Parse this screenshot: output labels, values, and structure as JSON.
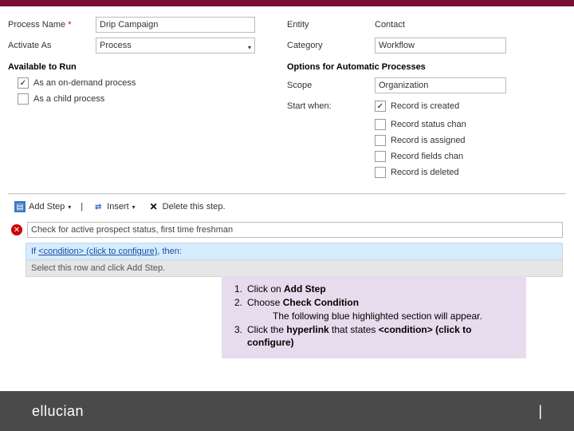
{
  "form": {
    "left": {
      "processNameLabel": "Process Name",
      "processNameValue": "Drip Campaign",
      "activateAsLabel": "Activate As",
      "activateAsValue": "Process"
    },
    "right": {
      "entityLabel": "Entity",
      "entityValue": "Contact",
      "categoryLabel": "Category",
      "categoryValue": "Workflow"
    },
    "availableHeader": "Available to Run",
    "chkOnDemand": "As an on-demand process",
    "chkChild": "As a child process",
    "optionsHeader": "Options for Automatic Processes",
    "scopeLabel": "Scope",
    "scopeValue": "Organization",
    "startWhenLabel": "Start when:",
    "swCreated": "Record is created",
    "swStatus": "Record status chan",
    "swAssigned": "Record is assigned",
    "swFields": "Record fields chan",
    "swDeleted": "Record is deleted"
  },
  "toolbar": {
    "addStep": "Add Step",
    "insert": "Insert",
    "delete": "Delete this step."
  },
  "step": {
    "desc": "Check for active prospect status, first time freshman"
  },
  "cond": {
    "ifPrefix": "If ",
    "ifLink": "<condition> (click to configure)",
    "ifSuffix": ", then:",
    "select": "Select this row and click Add Step."
  },
  "note": {
    "n1": "1.",
    "n2": "2.",
    "n3": "3.",
    "l1a": "Click on ",
    "l1b": "Add Step",
    "l2a": "Choose ",
    "l2b": "Check Condition",
    "l3": "The following blue highlighted section will appear.",
    "l4a": "Click the ",
    "l4b": "hyperlink",
    "l4c": " that states ",
    "l4d": "<condition> (click to configure)"
  },
  "footer": {
    "brand": "ellucian",
    "pipe": "|"
  }
}
